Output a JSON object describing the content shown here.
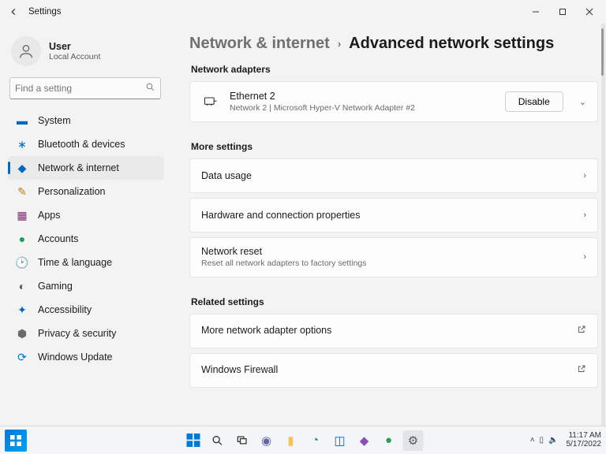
{
  "window_title": "Settings",
  "user": {
    "name": "User",
    "account_type": "Local Account"
  },
  "search": {
    "placeholder": "Find a setting"
  },
  "sidebar": {
    "items": [
      {
        "label": "System",
        "icon": "🖥️",
        "color": "#0067c0"
      },
      {
        "label": "Bluetooth & devices",
        "icon": "ᚼ",
        "color": "#0067c0"
      },
      {
        "label": "Network & internet",
        "icon": "📶",
        "color": "#0067c0",
        "active": true
      },
      {
        "label": "Personalization",
        "icon": "🖌️",
        "color": "#c07816"
      },
      {
        "label": "Apps",
        "icon": "▦",
        "color": "#7a2e6f"
      },
      {
        "label": "Accounts",
        "icon": "👤",
        "color": "#1f9c55"
      },
      {
        "label": "Time & language",
        "icon": "🕑",
        "color": "#3a3ad1"
      },
      {
        "label": "Gaming",
        "icon": "🎮",
        "color": "#575757"
      },
      {
        "label": "Accessibility",
        "icon": "✦",
        "color": "#0067c0"
      },
      {
        "label": "Privacy & security",
        "icon": "🛡️",
        "color": "#6b6b6b"
      },
      {
        "label": "Windows Update",
        "icon": "🔄",
        "color": "#0078d4"
      }
    ]
  },
  "breadcrumb": {
    "parent": "Network & internet",
    "current": "Advanced network settings"
  },
  "sections": {
    "adapters": {
      "heading": "Network adapters",
      "item": {
        "title": "Ethernet 2",
        "subtitle": "Network 2 | Microsoft Hyper-V Network Adapter #2",
        "action": "Disable"
      }
    },
    "more": {
      "heading": "More settings",
      "data_usage": "Data usage",
      "hardware": "Hardware and connection properties",
      "reset": {
        "title": "Network reset",
        "subtitle": "Reset all network adapters to factory settings"
      }
    },
    "related": {
      "heading": "Related settings",
      "more_adapter": "More network adapter options",
      "firewall": "Windows Firewall"
    }
  },
  "taskbar": {
    "time": "11:17 AM",
    "date": "5/17/2022"
  }
}
